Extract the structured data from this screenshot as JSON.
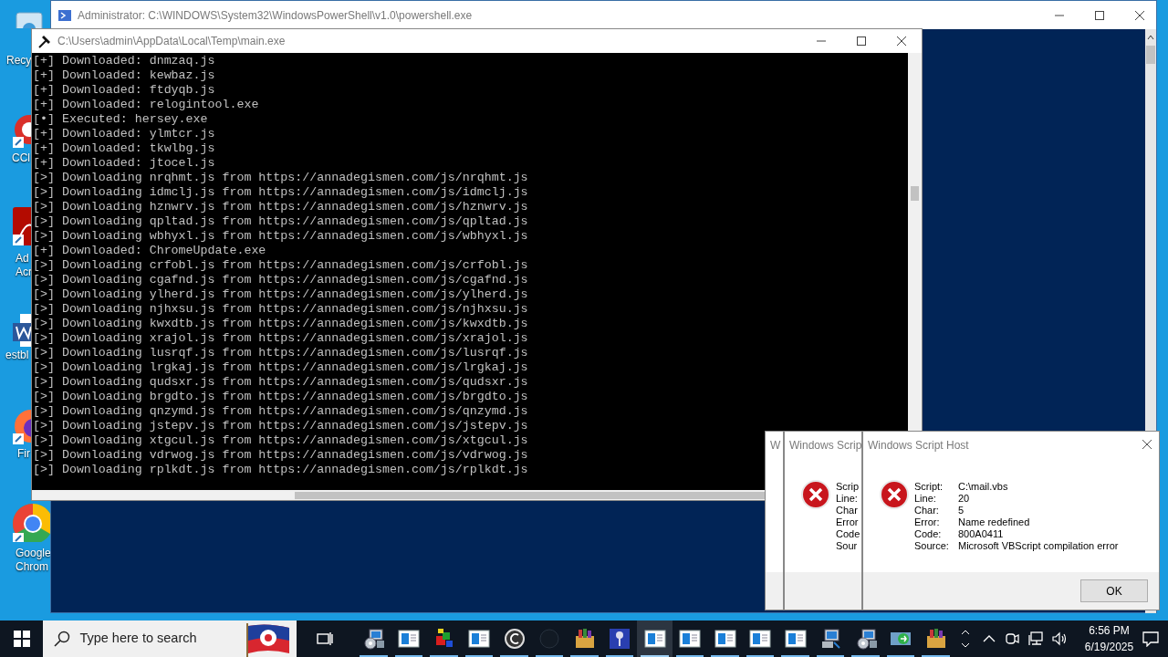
{
  "desktop_icons": [
    {
      "kind": "recycle",
      "label": [
        "Recy"
      ]
    },
    {
      "kind": "ccleaner",
      "label": [
        "CCl"
      ]
    },
    {
      "kind": "acrobat",
      "label": [
        "Ad",
        "Acr"
      ]
    },
    {
      "kind": "word",
      "label": [
        "estbl"
      ]
    },
    {
      "kind": "firefox",
      "label": [
        "Fir"
      ]
    },
    {
      "kind": "chrome",
      "label": [
        "Google",
        "Chrom"
      ]
    }
  ],
  "powershell_window": {
    "title": "Administrator: C:\\WINDOWS\\System32\\WindowsPowerShell\\v1.0\\powershell.exe"
  },
  "console_window": {
    "title": "C:\\Users\\admin\\AppData\\Local\\Temp\\main.exe",
    "lines": [
      "[+] Downloaded: dnmzaq.js",
      "[+] Downloaded: kewbaz.js",
      "[+] Downloaded: ftdyqb.js",
      "[+] Downloaded: relogintool.exe",
      "[•] Executed: hersey.exe",
      "[+] Downloaded: ylmtcr.js",
      "[+] Downloaded: tkwlbg.js",
      "[+] Downloaded: jtocel.js",
      "[>] Downloading nrqhmt.js from https://annadegismen.com/js/nrqhmt.js",
      "[>] Downloading idmclj.js from https://annadegismen.com/js/idmclj.js",
      "[>] Downloading hznwrv.js from https://annadegismen.com/js/hznwrv.js",
      "[>] Downloading qpltad.js from https://annadegismen.com/js/qpltad.js",
      "[>] Downloading wbhyxl.js from https://annadegismen.com/js/wbhyxl.js",
      "[+] Downloaded: ChromeUpdate.exe",
      "[>] Downloading crfobl.js from https://annadegismen.com/js/crfobl.js",
      "[>] Downloading cgafnd.js from https://annadegismen.com/js/cgafnd.js",
      "[>] Downloading ylherd.js from https://annadegismen.com/js/ylherd.js",
      "[>] Downloading njhxsu.js from https://annadegismen.com/js/njhxsu.js",
      "[>] Downloading kwxdtb.js from https://annadegismen.com/js/kwxdtb.js",
      "[>] Downloading xrajol.js from https://annadegismen.com/js/xrajol.js",
      "[>] Downloading lusrqf.js from https://annadegismen.com/js/lusrqf.js",
      "[>] Downloading lrgkaj.js from https://annadegismen.com/js/lrgkaj.js",
      "[>] Downloading qudsxr.js from https://annadegismen.com/js/qudsxr.js",
      "[>] Downloading brgdto.js from https://annadegismen.com/js/brgdto.js",
      "[>] Downloading qnzymd.js from https://annadegismen.com/js/qnzymd.js",
      "[>] Downloading jstepv.js from https://annadegismen.com/js/jstepv.js",
      "[>] Downloading xtgcul.js from https://annadegismen.com/js/xtgcul.js",
      "[>] Downloading vdrwog.js from https://annadegismen.com/js/vdrwog.js",
      "[>] Downloading rplkdt.js from https://annadegismen.com/js/rplkdt.js"
    ]
  },
  "dialogs": [
    {
      "title": "W"
    },
    {
      "title": "Windows Scrip",
      "labels": [
        "Scrip",
        "Line:",
        "Char",
        "Error",
        "Code",
        "Sour"
      ]
    },
    {
      "title": "Windows Script Host",
      "labels": [
        "Script:",
        "Line:",
        "Char:",
        "Error:",
        "Code:",
        "Source:"
      ],
      "values": [
        "C:\\mail.vbs",
        "20",
        "5",
        "Name redefined",
        "800A0411",
        "Microsoft VBScript compilation error"
      ],
      "button": "OK"
    }
  ],
  "taskbar": {
    "search_placeholder": "Type here to search",
    "apps": [
      {
        "kind": "computer-disc",
        "selected": false
      },
      {
        "kind": "window",
        "selected": false
      },
      {
        "kind": "blocks",
        "selected": false
      },
      {
        "kind": "window",
        "selected": false
      },
      {
        "kind": "ring",
        "selected": false
      },
      {
        "kind": "dark",
        "selected": false
      },
      {
        "kind": "box",
        "selected": false
      },
      {
        "kind": "key",
        "selected": false
      },
      {
        "kind": "window",
        "selected": true
      },
      {
        "kind": "window",
        "selected": false
      },
      {
        "kind": "window",
        "selected": false
      },
      {
        "kind": "window",
        "selected": false
      },
      {
        "kind": "window",
        "selected": false
      },
      {
        "kind": "computer",
        "selected": false
      },
      {
        "kind": "computer-disc",
        "selected": false
      },
      {
        "kind": "arrows",
        "selected": false
      },
      {
        "kind": "box",
        "selected": false
      }
    ],
    "time": "6:56 PM",
    "date": "6/19/2025"
  }
}
